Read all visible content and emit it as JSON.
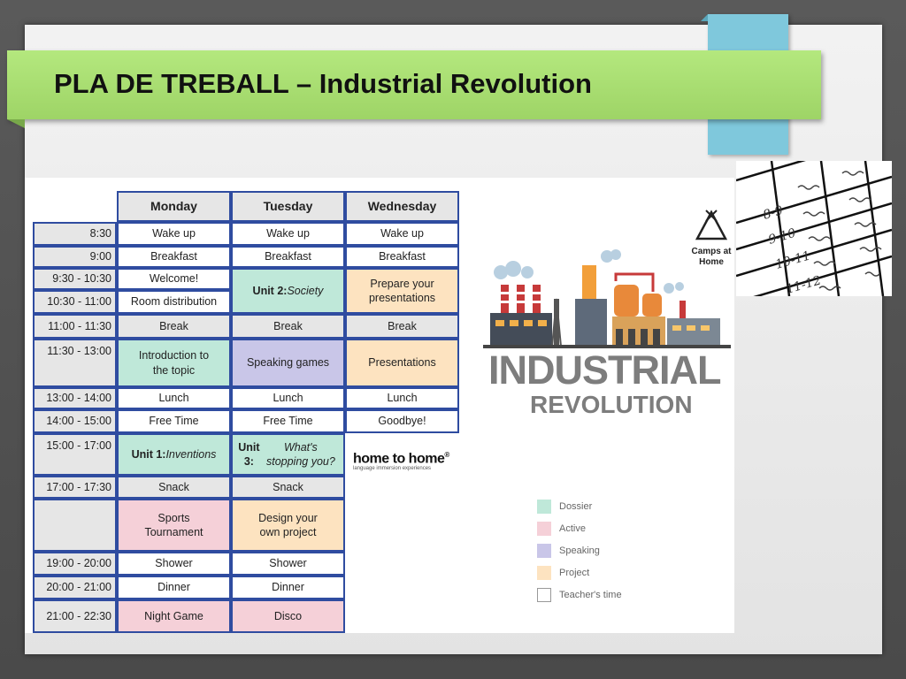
{
  "title": "PLA DE TREBALL – Industrial Revolution",
  "headers": [
    "Monday",
    "Tuesday",
    "Wednesday"
  ],
  "times": [
    "8:30",
    "9:00",
    "9:30 - 10:30",
    "10:30 - 11:00",
    "11:00 - 11:30",
    "11:30 - 13:00",
    "13:00 - 14:00",
    "14:00 - 15:00",
    "15:00 - 17:00",
    "17:00 - 17:30",
    "",
    "19:00 - 20:00",
    "20:00 - 21:00",
    "21:00 - 22:30"
  ],
  "schedule": {
    "monday": [
      "Wake up",
      "Breakfast",
      "Welcome!",
      "Room distribution",
      "Break",
      "Introduction to the topic",
      "Lunch",
      "Free Time",
      "Unit 1: Inventions",
      "Snack",
      "Sports Tournament",
      "Shower",
      "Dinner",
      "Night Game"
    ],
    "tuesday": [
      "Wake up",
      "Breakfast",
      "Unit 2: Society",
      "Break",
      "Speaking games",
      "Lunch",
      "Free Time",
      "Unit 3: What's stopping you?",
      "Snack",
      "Design your own project",
      "Shower",
      "Dinner",
      "Disco"
    ],
    "wednesday": [
      "Wake up",
      "Breakfast",
      "Prepare your presentations",
      "Break",
      "Presentations",
      "Lunch",
      "Goodbye!"
    ]
  },
  "legend": [
    {
      "label": "Dossier",
      "color": "#bfe8d9"
    },
    {
      "label": "Active",
      "color": "#f5d0d8"
    },
    {
      "label": "Speaking",
      "color": "#c9c6e8"
    },
    {
      "label": "Project",
      "color": "#fde3c0"
    },
    {
      "label": "Teacher's time",
      "color": "#ffffff"
    }
  ],
  "poster": {
    "heading": "INDUSTRIAL",
    "subheading": "REVOLUTION"
  },
  "logos": {
    "camps": "Camps at Home",
    "home_to_home": "home to home",
    "home_to_home_tagline": "language immersion experiences"
  },
  "note_times": [
    "8-9",
    "9-10",
    "10-11",
    "11-12"
  ],
  "colors": {
    "banner": "#a8dd70",
    "grid_border": "#2f4ca0",
    "accent_blue": "#7fc8dc"
  }
}
